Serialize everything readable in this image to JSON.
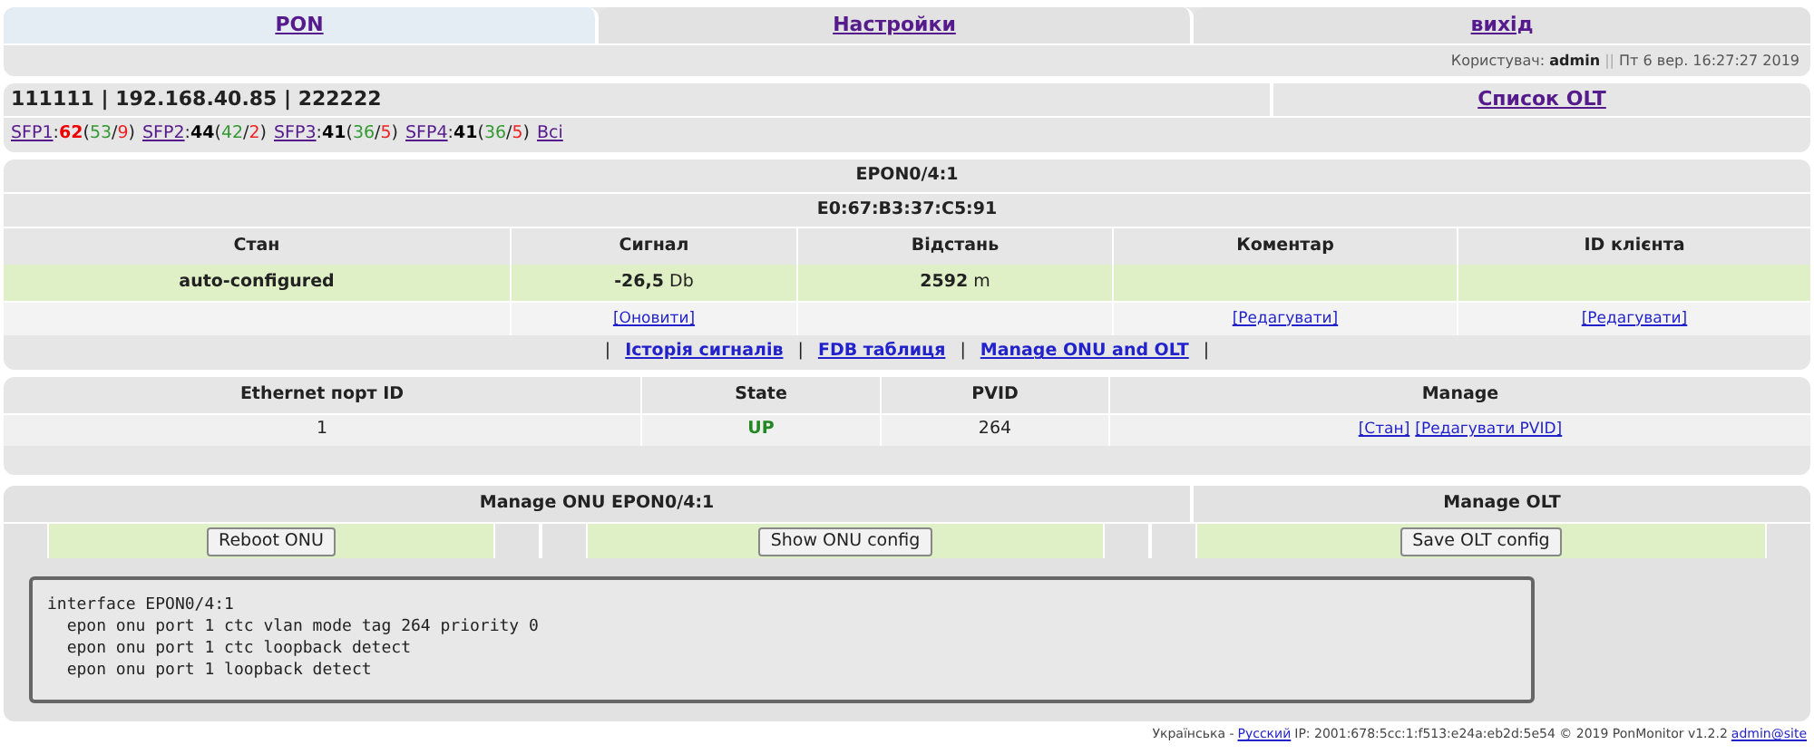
{
  "nav_tabs": [
    {
      "label": "PON",
      "selected": true
    },
    {
      "label": "Настройки",
      "selected": false
    },
    {
      "label": "вихід",
      "selected": false
    }
  ],
  "user_info": {
    "label": "Користувач:",
    "user": "admin",
    "separator": "||",
    "datetime": "Пт 6 вер. 16:27:27 2019"
  },
  "olt_header": {
    "title": "111111 | 192.168.40.85 | 222222",
    "olt_list_link": "Список OLT"
  },
  "sfp_ports": [
    {
      "label": "SFP1",
      "parts": [
        {
          "kind": "plain",
          "text": ":"
        },
        {
          "kind": "alert",
          "text": "62"
        },
        {
          "kind": "plain",
          "text": "("
        },
        {
          "kind": "online",
          "text": "53"
        },
        {
          "kind": "plain",
          "text": "/"
        },
        {
          "kind": "offline",
          "text": "9"
        },
        {
          "kind": "plain",
          "text": ")"
        }
      ]
    },
    {
      "label": "SFP2",
      "parts": [
        {
          "kind": "plain",
          "text": ":"
        },
        {
          "kind": "total",
          "text": "44"
        },
        {
          "kind": "plain",
          "text": "("
        },
        {
          "kind": "online",
          "text": "42"
        },
        {
          "kind": "plain",
          "text": "/"
        },
        {
          "kind": "offline",
          "text": "2"
        },
        {
          "kind": "plain",
          "text": ")"
        }
      ]
    },
    {
      "label": "SFP3",
      "parts": [
        {
          "kind": "plain",
          "text": ":"
        },
        {
          "kind": "total",
          "text": "41"
        },
        {
          "kind": "plain",
          "text": "("
        },
        {
          "kind": "online",
          "text": "36"
        },
        {
          "kind": "plain",
          "text": "/"
        },
        {
          "kind": "offline",
          "text": "5"
        },
        {
          "kind": "plain",
          "text": ")"
        }
      ]
    },
    {
      "label": "SFP4",
      "parts": [
        {
          "kind": "plain",
          "text": ":"
        },
        {
          "kind": "total",
          "text": "41"
        },
        {
          "kind": "plain",
          "text": "("
        },
        {
          "kind": "online",
          "text": "36"
        },
        {
          "kind": "plain",
          "text": "/"
        },
        {
          "kind": "offline",
          "text": "5"
        },
        {
          "kind": "plain",
          "text": ")"
        }
      ]
    }
  ],
  "sfp_all_link": "Всі",
  "onu": {
    "name": "EPON0/4:1",
    "mac": "E0:67:B3:37:C5:91",
    "columns": [
      "Стан",
      "Сигнал",
      "Відстань",
      "Коментар",
      "ID клієнта"
    ],
    "status": "auto-configured",
    "signal": "-26,5",
    "signal_unit": "Db",
    "distance": "2592",
    "distance_unit": "m",
    "actions": {
      "signal": "[Оновити]",
      "comment": "[Редагувати]",
      "client_id": "[Редагувати]"
    },
    "link_separator": "|",
    "links": [
      "Історія сигналів",
      "FDB таблиця",
      "Manage ONU and OLT"
    ]
  },
  "ports": {
    "columns": [
      "Ethernet порт ID",
      "State",
      "PVID",
      "Manage"
    ],
    "rows": [
      {
        "id": "1",
        "state": "UP",
        "up": true,
        "pvid": "264",
        "actions": [
          "[Стан]",
          "[Редагувати PVID]"
        ]
      }
    ]
  },
  "manage": {
    "onu_title": "Manage ONU EPON0/4:1",
    "olt_title": "Manage OLT",
    "buttons": [
      "Reboot ONU",
      "Show ONU config",
      "Save OLT config"
    ]
  },
  "config_output": [
    "interface EPON0/4:1",
    "  epon onu port 1 ctc vlan mode tag 264 priority 0",
    "  epon onu port 1 ctc loopback detect",
    "  epon onu port 1 loopback detect"
  ],
  "footer": {
    "lang_current": "Українська -",
    "lang_link": "Русский",
    "info": "IP: 2001:678:5cc:1:f513:e24a:eb2d:5e54 © 2019 PonMonitor v1.2.2",
    "user_link": "admin@site"
  }
}
